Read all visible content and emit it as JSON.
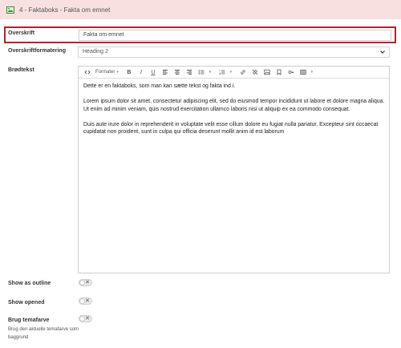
{
  "header": {
    "title": "4 - Faktaboks - Fakta om emnet",
    "icon": "image-icon"
  },
  "fields": {
    "overskrift": {
      "label": "Overskrift",
      "value": "Fakta om emnet"
    },
    "overskriftformatering": {
      "label": "Overskriftformatering",
      "selected": "Heading 2"
    },
    "brodtekst": {
      "label": "Brødtekst"
    },
    "show_as_outline": {
      "label": "Show as outline",
      "toggle_symbol": "✕"
    },
    "show_opened": {
      "label": "Show opened",
      "toggle_symbol": "✕"
    },
    "brug_temafarve": {
      "label": "Brug temafarve",
      "description": "Brug den aktuelle temafarve som baggrund",
      "toggle_symbol": "✕"
    }
  },
  "toolbar": {
    "formatter_label": "Formater",
    "buttons": [
      "source-code-icon",
      "formatter-dropdown",
      "bold-icon",
      "italic-icon",
      "underline-icon",
      "align-left-icon",
      "align-center-icon",
      "align-right-icon",
      "bullet-list-icon",
      "numbered-list-icon",
      "link-icon",
      "unlink-icon",
      "image-icon",
      "bookmark-icon",
      "key-icon",
      "table-icon"
    ]
  },
  "editor": {
    "paragraphs": [
      "Dette er en faktaboks, som man kan sætte tekst og fakta ind i.",
      "Lorem ipsum dolor sit amet, consectetur adipiscing elit, sed do eiusmod tempor incididunt ut labore et dolore magna aliqua. Ut enim ad minim veniam, quis nostrud exercitation ullamco laboris nisi ut aliquip ex ea commodo consequat.",
      "Duis aute irure dolor in reprehenderit in voluptate velit esse cillum dolore eu fugiat nulla pariatur. Excepteur sint occaecat cupidatat non proident, sunt in culpa qui officia deserunt mollit anim id est laborum"
    ]
  },
  "colors": {
    "header_bg": "#f9e0e0",
    "highlight_border": "#b8202e"
  }
}
